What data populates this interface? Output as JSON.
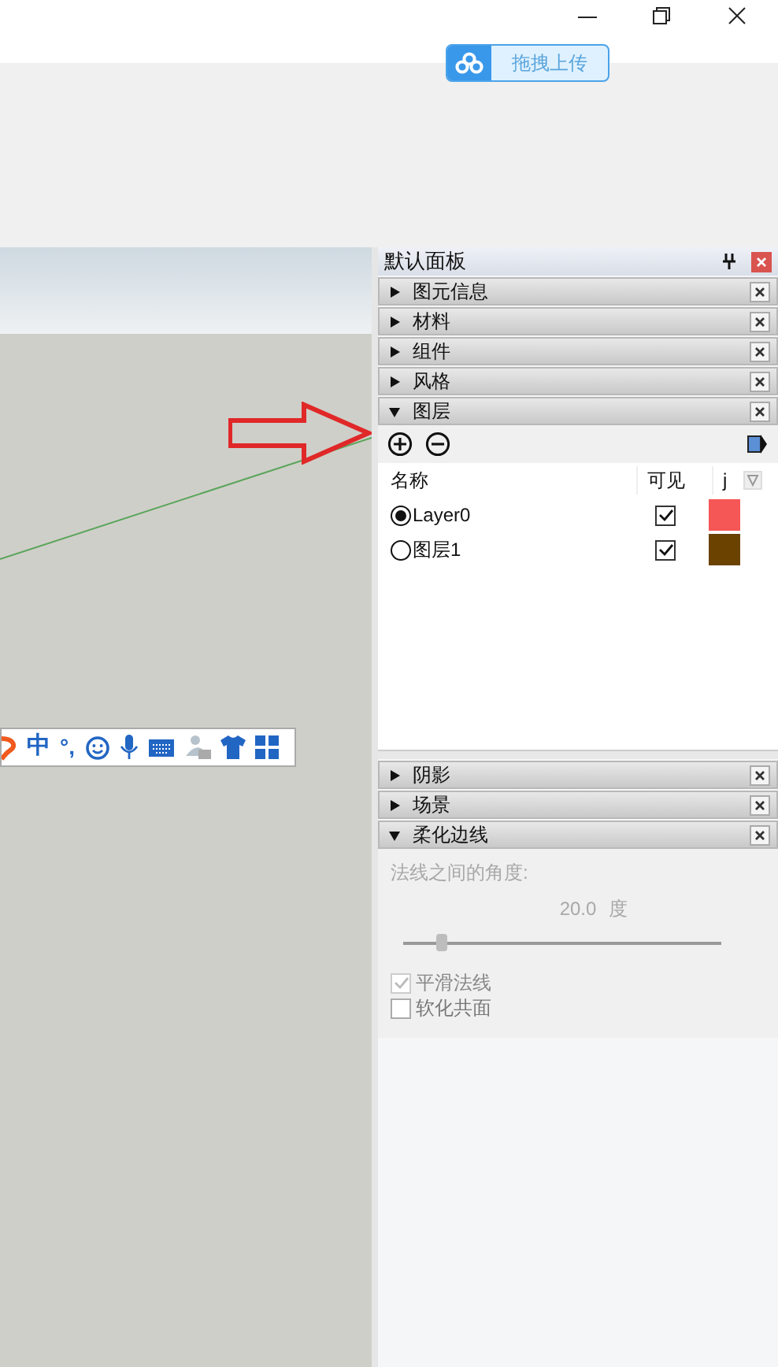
{
  "upload_button": {
    "label": "拖拽上传"
  },
  "ime_toolbar": {
    "mode": "中",
    "punctuation": "°,"
  },
  "panel": {
    "title": "默认面板",
    "sections": [
      {
        "title": "图元信息",
        "expanded": false
      },
      {
        "title": "材料",
        "expanded": false
      },
      {
        "title": "组件",
        "expanded": false
      },
      {
        "title": "风格",
        "expanded": false
      },
      {
        "title": "图层",
        "expanded": true,
        "kind": "layers",
        "columns": [
          "名称",
          "可见",
          "j"
        ],
        "rows": [
          {
            "name": "Layer0",
            "selected": true,
            "visible": true,
            "color": "#f55656"
          },
          {
            "name": "图层1",
            "selected": false,
            "visible": true,
            "color": "#6b4200"
          }
        ]
      },
      {
        "title": "阴影",
        "expanded": false
      },
      {
        "title": "场景",
        "expanded": false
      },
      {
        "title": "柔化边线",
        "expanded": true,
        "kind": "soften",
        "angle_label": "法线之间的角度:",
        "value": "20.0",
        "unit": "度",
        "level": 0.12,
        "options": [
          {
            "label": "平滑法线",
            "checked": true,
            "disabled": true
          },
          {
            "label": "软化共面",
            "checked": false,
            "disabled": false
          }
        ]
      }
    ]
  }
}
